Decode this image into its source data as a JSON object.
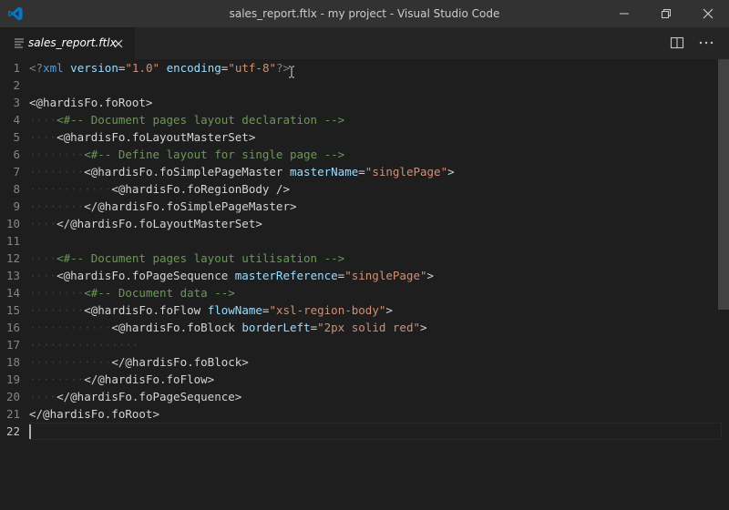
{
  "window": {
    "title": "sales_report.ftlx - my project - Visual Studio Code",
    "controls": [
      "minimize-icon",
      "restore-icon",
      "close-icon"
    ]
  },
  "tabs": [
    {
      "label": "sales_report.ftlx",
      "active": true,
      "icon": "file-lines-icon",
      "close_icon": "close-icon"
    }
  ],
  "editor_actions": [
    "split-editor-icon",
    "more-actions-icon"
  ],
  "editor": {
    "active_line": 22,
    "lines": [
      {
        "n": "1",
        "indent": 0,
        "tokens": [
          [
            "punct",
            "<?"
          ],
          [
            "tag",
            "xml"
          ],
          [
            "txt",
            " "
          ],
          [
            "attr",
            "version"
          ],
          [
            "txt",
            "="
          ],
          [
            "str",
            "\"1.0\""
          ],
          [
            "txt",
            " "
          ],
          [
            "attr",
            "encoding"
          ],
          [
            "txt",
            "="
          ],
          [
            "str",
            "\"utf-8\""
          ],
          [
            "punct",
            "?>"
          ]
        ]
      },
      {
        "n": "2",
        "indent": 0,
        "tokens": []
      },
      {
        "n": "3",
        "indent": 0,
        "tokens": [
          [
            "txt",
            "<@hardisFo.foRoot>"
          ]
        ]
      },
      {
        "n": "4",
        "indent": 1,
        "tokens": [
          [
            "cmt",
            "<#-- Document pages layout declaration -->"
          ]
        ]
      },
      {
        "n": "5",
        "indent": 1,
        "tokens": [
          [
            "txt",
            "<@hardisFo.foLayoutMasterSet>"
          ]
        ]
      },
      {
        "n": "6",
        "indent": 2,
        "tokens": [
          [
            "cmt",
            "<#-- Define layout for single page -->"
          ]
        ]
      },
      {
        "n": "7",
        "indent": 2,
        "tokens": [
          [
            "txt",
            "<@hardisFo.foSimplePageMaster "
          ],
          [
            "attr",
            "masterName"
          ],
          [
            "txt",
            "="
          ],
          [
            "str",
            "\"singlePage\""
          ],
          [
            "txt",
            ">"
          ]
        ]
      },
      {
        "n": "8",
        "indent": 3,
        "tokens": [
          [
            "txt",
            "<@hardisFo.foRegionBody />"
          ]
        ]
      },
      {
        "n": "9",
        "indent": 2,
        "tokens": [
          [
            "txt",
            "</@hardisFo.foSimplePageMaster>"
          ]
        ]
      },
      {
        "n": "10",
        "indent": 1,
        "tokens": [
          [
            "txt",
            "</@hardisFo.foLayoutMasterSet>"
          ]
        ]
      },
      {
        "n": "11",
        "indent": 0,
        "tokens": []
      },
      {
        "n": "12",
        "indent": 1,
        "tokens": [
          [
            "cmt",
            "<#-- Document pages layout utilisation -->"
          ]
        ]
      },
      {
        "n": "13",
        "indent": 1,
        "tokens": [
          [
            "txt",
            "<@hardisFo.foPageSequence "
          ],
          [
            "attr",
            "masterReference"
          ],
          [
            "txt",
            "="
          ],
          [
            "str",
            "\"singlePage\""
          ],
          [
            "txt",
            ">"
          ]
        ]
      },
      {
        "n": "14",
        "indent": 2,
        "tokens": [
          [
            "cmt",
            "<#-- Document data -->"
          ]
        ]
      },
      {
        "n": "15",
        "indent": 2,
        "tokens": [
          [
            "txt",
            "<@hardisFo.foFlow "
          ],
          [
            "attr",
            "flowName"
          ],
          [
            "txt",
            "="
          ],
          [
            "str",
            "\"xsl-region-body\""
          ],
          [
            "txt",
            ">"
          ]
        ]
      },
      {
        "n": "16",
        "indent": 3,
        "tokens": [
          [
            "txt",
            "<@hardisFo.foBlock "
          ],
          [
            "attr",
            "borderLeft"
          ],
          [
            "txt",
            "="
          ],
          [
            "str",
            "\"2px solid red\""
          ],
          [
            "txt",
            ">"
          ]
        ]
      },
      {
        "n": "17",
        "indent": 4,
        "tokens": []
      },
      {
        "n": "18",
        "indent": 3,
        "tokens": [
          [
            "txt",
            "</@hardisFo.foBlock>"
          ]
        ]
      },
      {
        "n": "19",
        "indent": 2,
        "tokens": [
          [
            "txt",
            "</@hardisFo.foFlow>"
          ]
        ]
      },
      {
        "n": "20",
        "indent": 1,
        "tokens": [
          [
            "txt",
            "</@hardisFo.foPageSequence>"
          ]
        ]
      },
      {
        "n": "21",
        "indent": 0,
        "tokens": [
          [
            "txt",
            "</@hardisFo.foRoot>"
          ]
        ]
      },
      {
        "n": "22",
        "indent": 0,
        "tokens": []
      }
    ]
  },
  "colors": {
    "background": "#1e1e1e",
    "titlebar": "#323233",
    "tag": "#569cd6",
    "attribute": "#9cdcfe",
    "string": "#ce9178",
    "comment": "#6a9955",
    "text": "#d4d4d4",
    "accent": "#007acc"
  }
}
